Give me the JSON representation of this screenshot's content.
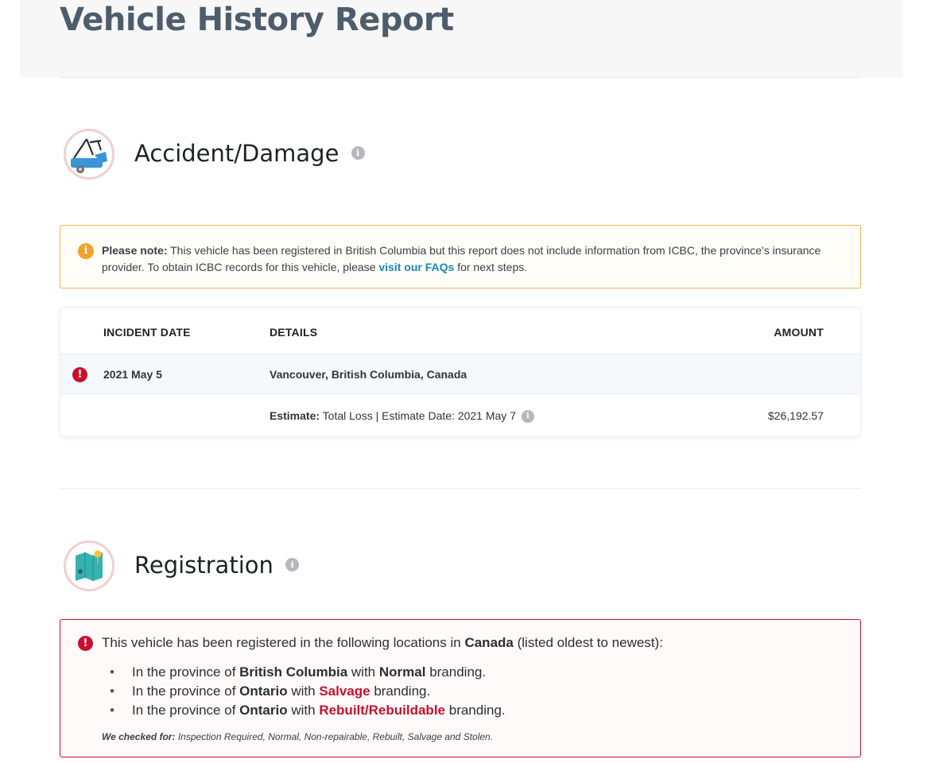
{
  "header": {
    "title": "Vehicle History Report"
  },
  "accident_section": {
    "title": "Accident/Damage",
    "icon": "tow-truck-icon",
    "note": {
      "label": "Please note:",
      "text_before_link": "This vehicle has been registered in British Columbia but this report does not include information from ICBC, the province's insurance provider. To obtain ICBC records for this vehicle, please",
      "link_text": "visit our FAQs",
      "text_after_link": "for next steps."
    },
    "table": {
      "columns": [
        "INCIDENT DATE",
        "DETAILS",
        "AMOUNT"
      ],
      "incident": {
        "date": "2021 May 5",
        "location": "Vancouver, British Columbia, Canada",
        "estimate_label": "Estimate:",
        "estimate_text": "Total Loss | Estimate Date: 2021 May 7",
        "amount": "$26,192.57"
      }
    }
  },
  "registration_section": {
    "title": "Registration",
    "icon": "map-icon",
    "intro_before": "This vehicle has been registered in the following locations in",
    "intro_country": "Canada",
    "intro_after": "(listed oldest to newest):",
    "bullet": "•",
    "items": [
      {
        "prefix": "In the province of",
        "province": "British Columbia",
        "with": "with",
        "brand": "Normal",
        "suffix": "branding.",
        "alert": false
      },
      {
        "prefix": "In the province of",
        "province": "Ontario",
        "with": "with",
        "brand": "Salvage",
        "suffix": "branding.",
        "alert": true
      },
      {
        "prefix": "In the province of",
        "province": "Ontario",
        "with": "with",
        "brand": "Rebuilt/Rebuildable",
        "suffix": "branding.",
        "alert": true
      }
    ],
    "checked_label": "We checked for:",
    "checked_list": "Inspection Required, Normal, Non-repairable, Rebuilt, Salvage and Stolen."
  },
  "colors": {
    "alert_red": "#c8102e",
    "note_orange": "#f0a22a",
    "link_blue": "#1a86b9",
    "title_slate": "#4d5d6b"
  }
}
